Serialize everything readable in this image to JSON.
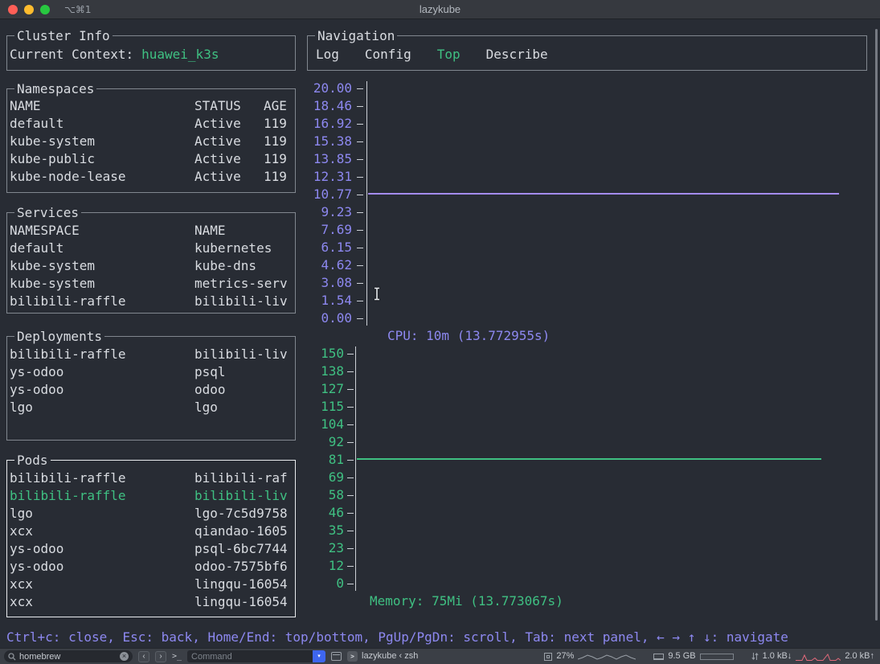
{
  "window": {
    "title": "lazykube",
    "tab_shortcut": "⌥⌘1"
  },
  "panels": {
    "cluster_info": {
      "title": "Cluster Info",
      "context_label": "Current Context:",
      "context_value": "huawei_k3s"
    },
    "namespaces": {
      "title": "Namespaces",
      "headers": [
        "NAME",
        "STATUS",
        "AGE"
      ],
      "rows": [
        [
          "default",
          "Active",
          "119"
        ],
        [
          "kube-system",
          "Active",
          "119"
        ],
        [
          "kube-public",
          "Active",
          "119"
        ],
        [
          "kube-node-lease",
          "Active",
          "119"
        ]
      ]
    },
    "services": {
      "title": "Services",
      "headers": [
        "NAMESPACE",
        "NAME"
      ],
      "rows": [
        [
          "default",
          "kubernetes"
        ],
        [
          "kube-system",
          "kube-dns"
        ],
        [
          "kube-system",
          "metrics-serv"
        ],
        [
          "bilibili-raffle",
          "bilibili-liv"
        ]
      ]
    },
    "deployments": {
      "title": "Deployments",
      "rows": [
        [
          "bilibili-raffle",
          "bilibili-liv"
        ],
        [
          "ys-odoo",
          "psql"
        ],
        [
          "ys-odoo",
          "odoo"
        ],
        [
          "lgo",
          "lgo"
        ]
      ]
    },
    "pods": {
      "title": "Pods",
      "selected_index": 1,
      "rows": [
        [
          "bilibili-raffle",
          "bilibili-raf"
        ],
        [
          "bilibili-raffle",
          "bilibili-liv"
        ],
        [
          "lgo",
          "lgo-7c5d9758"
        ],
        [
          "xcx",
          "qiandao-1605"
        ],
        [
          "ys-odoo",
          "psql-6bc7744"
        ],
        [
          "ys-odoo",
          "odoo-7575bf6"
        ],
        [
          "xcx",
          "lingqu-16054"
        ],
        [
          "xcx",
          "lingqu-16054"
        ]
      ]
    },
    "navigation": {
      "title": "Navigation",
      "tabs": [
        "Log",
        "Config",
        "Top",
        "Describe"
      ],
      "active_tab": "Top"
    }
  },
  "chart_data": [
    {
      "type": "line",
      "title": "CPU: 10m (13.772955s)",
      "y_ticks": [
        "20.00",
        "18.46",
        "16.92",
        "15.38",
        "13.85",
        "12.31",
        "10.77",
        "9.23",
        "7.69",
        "6.15",
        "4.62",
        "3.08",
        "1.54",
        "0.00"
      ],
      "ylim": [
        0,
        20
      ],
      "grid": false,
      "series": [
        {
          "name": "cpu-usage",
          "value": 10.77,
          "style": "flat-horizontal-line",
          "color": "#a48cf2"
        }
      ]
    },
    {
      "type": "line",
      "title": "Memory: 75Mi (13.773067s)",
      "y_ticks": [
        "150",
        "138",
        "127",
        "115",
        "104",
        "92",
        "81",
        "69",
        "58",
        "46",
        "35",
        "23",
        "12",
        "0"
      ],
      "ylim": [
        0,
        150
      ],
      "grid": false,
      "series": [
        {
          "name": "memory-usage",
          "value": 81,
          "style": "flat-horizontal-line",
          "color": "#3fc082"
        }
      ]
    }
  ],
  "help_bar": "Ctrl+c: close, Esc: back, Home/End: top/bottom, PgUp/PgDn: scroll, Tab: next panel, ← → ↑ ↓: navigate",
  "status_bar": {
    "search_value": "homebrew",
    "clear_label": "×",
    "back_label": "‹",
    "forward_label": "›",
    "prompt_label": ">_",
    "command_placeholder": "Command",
    "dropdown_glyph": "▾",
    "session_label": "lazykube ‹ zsh",
    "cpu_percent": "27%",
    "memory_usage": "9.5 GB",
    "net_down": "1.0 kB↓",
    "net_up": "2.0 kB↑"
  },
  "colors": {
    "background": "#282c34",
    "foreground": "#d9dce1",
    "green_accent": "#3fc082",
    "purple_accent": "#8d88f0",
    "cpu_line": "#a48cf2",
    "memory_line": "#3fc082",
    "panel_border": "#81878f",
    "active_panel_border": "#e9ebee"
  }
}
